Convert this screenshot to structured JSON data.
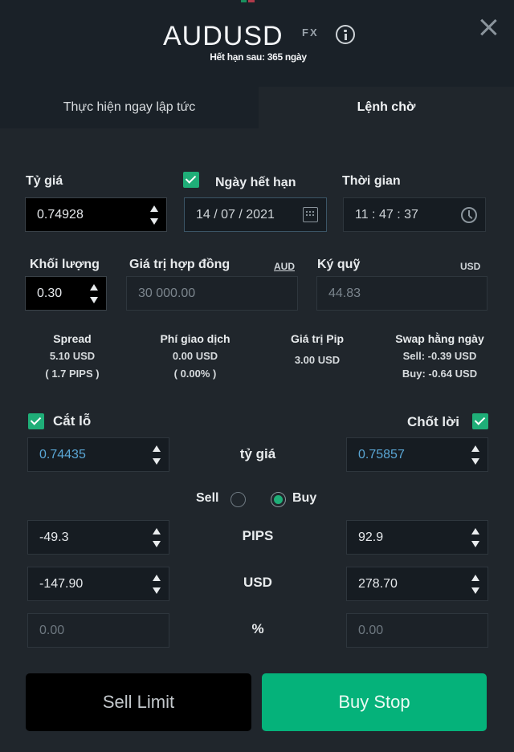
{
  "header": {
    "symbol": "AUDUSD",
    "asset_class": "FX",
    "expiry_text": "Hết hạn sau: 365 ngày",
    "icons": {
      "info": "info-icon",
      "close": "close-icon"
    }
  },
  "tabs": [
    {
      "label": "Thực hiện ngay lập tức",
      "active": false
    },
    {
      "label": "Lệnh chờ",
      "active": true
    }
  ],
  "order": {
    "rate": {
      "label": "Tỷ giá",
      "value": "0.74928"
    },
    "expiry_date": {
      "label": "Ngày hết hạn",
      "checked": true,
      "value": "14 / 07 / 2021",
      "icon": "calendar-icon"
    },
    "time": {
      "label": "Thời gian",
      "value": "11 : 47 : 37",
      "icon": "clock-icon"
    },
    "volume": {
      "label": "Khối lượng",
      "value": "0.30"
    },
    "contract_value": {
      "label": "Giá trị hợp đồng",
      "currency": "AUD",
      "value": "30 000.00"
    },
    "margin": {
      "label": "Ký quỹ",
      "currency": "USD",
      "value": "44.83"
    }
  },
  "stats": {
    "spread": {
      "title": "Spread",
      "line1": "5.10 USD",
      "line2": "( 1.7 PIPS )"
    },
    "fee": {
      "title": "Phí giao dịch",
      "line1": "0.00 USD",
      "line2": "( 0.00% )"
    },
    "pip_value": {
      "title": "Giá trị Pip",
      "line1": "3.00 USD"
    },
    "swap": {
      "title": "Swap hằng ngày",
      "line1": "Sell: -0.39 USD",
      "line2": "Buy: -0.64 USD"
    }
  },
  "stop_loss": {
    "label": "Cắt lỗ",
    "checked": true,
    "rate": "0.74435",
    "pips": "-49.3",
    "usd": "-147.90",
    "percent": "0.00"
  },
  "take_profit": {
    "label": "Chốt lời",
    "checked": true,
    "rate": "0.75857",
    "pips": "92.9",
    "usd": "278.70",
    "percent": "0.00"
  },
  "middle_labels": {
    "rate": "tỷ giá",
    "pips": "PIPS",
    "usd": "USD",
    "percent": "%"
  },
  "direction": {
    "sell_label": "Sell",
    "buy_label": "Buy",
    "selected": "Buy"
  },
  "actions": {
    "sell_label": "Sell Limit",
    "buy_label": "Buy Stop"
  },
  "colors": {
    "accent_green": "#05b27a",
    "checkbox_green": "#1fae78",
    "value_blue": "#5aa7d6",
    "background": "#20262c",
    "header_background": "#1a2128"
  }
}
